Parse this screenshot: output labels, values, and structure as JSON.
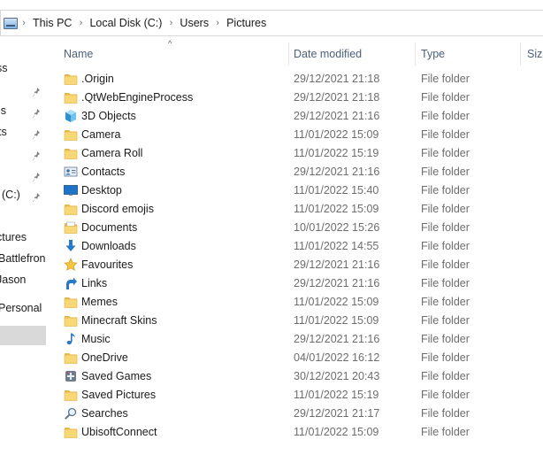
{
  "address_bar": {
    "crumbs": [
      "This PC",
      "Local Disk (C:)",
      "Users",
      "Pictures"
    ]
  },
  "nav": {
    "items": [
      {
        "label": "ss",
        "pinned": false
      },
      {
        "label": "",
        "pinned": true
      },
      {
        "label": "ls",
        "pinned": true
      },
      {
        "label": "ts",
        "pinned": true
      },
      {
        "label": "",
        "pinned": true
      },
      {
        "label": "",
        "pinned": true
      },
      {
        "label": "(C:)",
        "pinned": true
      },
      {
        "label": "ctures",
        "pinned": false
      },
      {
        "label": "Battlefron",
        "pinned": false
      },
      {
        "label": "Jason",
        "pinned": false
      },
      {
        "label": "Personal",
        "pinned": false
      },
      {
        "label": "",
        "pinned": false,
        "selected": true
      }
    ]
  },
  "columns": {
    "name": "Name",
    "date": "Date modified",
    "type": "Type",
    "size": "Size"
  },
  "files": [
    {
      "name": ".Origin",
      "date": "29/12/2021 21:18",
      "type": "File folder",
      "icon": "folder-icon"
    },
    {
      "name": ".QtWebEngineProcess",
      "date": "29/12/2021 21:18",
      "type": "File folder",
      "icon": "folder-icon"
    },
    {
      "name": "3D Objects",
      "date": "29/12/2021 21:16",
      "type": "File folder",
      "icon": "3d-objects-icon"
    },
    {
      "name": "Camera",
      "date": "11/01/2022 15:09",
      "type": "File folder",
      "icon": "folder-icon"
    },
    {
      "name": "Camera Roll",
      "date": "11/01/2022 15:19",
      "type": "File folder",
      "icon": "folder-icon"
    },
    {
      "name": "Contacts",
      "date": "29/12/2021 21:16",
      "type": "File folder",
      "icon": "contacts-icon"
    },
    {
      "name": "Desktop",
      "date": "11/01/2022 15:40",
      "type": "File folder",
      "icon": "desktop-icon"
    },
    {
      "name": "Discord emojis",
      "date": "11/01/2022 15:09",
      "type": "File folder",
      "icon": "folder-icon"
    },
    {
      "name": "Documents",
      "date": "10/01/2022 15:26",
      "type": "File folder",
      "icon": "documents-icon"
    },
    {
      "name": "Downloads",
      "date": "11/01/2022 14:55",
      "type": "File folder",
      "icon": "downloads-icon"
    },
    {
      "name": "Favourites",
      "date": "29/12/2021 21:16",
      "type": "File folder",
      "icon": "favourites-icon"
    },
    {
      "name": "Links",
      "date": "29/12/2021 21:16",
      "type": "File folder",
      "icon": "links-icon"
    },
    {
      "name": "Memes",
      "date": "11/01/2022 15:09",
      "type": "File folder",
      "icon": "folder-icon"
    },
    {
      "name": "Minecraft Skins",
      "date": "11/01/2022 15:09",
      "type": "File folder",
      "icon": "folder-icon"
    },
    {
      "name": "Music",
      "date": "29/12/2021 21:16",
      "type": "File folder",
      "icon": "music-icon"
    },
    {
      "name": "OneDrive",
      "date": "04/01/2022 16:12",
      "type": "File folder",
      "icon": "folder-icon"
    },
    {
      "name": "Saved Games",
      "date": "30/12/2021 20:43",
      "type": "File folder",
      "icon": "saved-games-icon"
    },
    {
      "name": "Saved Pictures",
      "date": "11/01/2022 15:19",
      "type": "File folder",
      "icon": "folder-icon"
    },
    {
      "name": "Searches",
      "date": "29/12/2021 21:17",
      "type": "File folder",
      "icon": "searches-icon"
    },
    {
      "name": "UbisoftConnect",
      "date": "11/01/2022 15:09",
      "type": "File folder",
      "icon": "folder-icon"
    }
  ],
  "colors": {
    "folder": "#f7d270",
    "header_text": "#4c607a",
    "secondary_text": "#6d6d6d",
    "selected_bg": "#d9d9d9"
  }
}
